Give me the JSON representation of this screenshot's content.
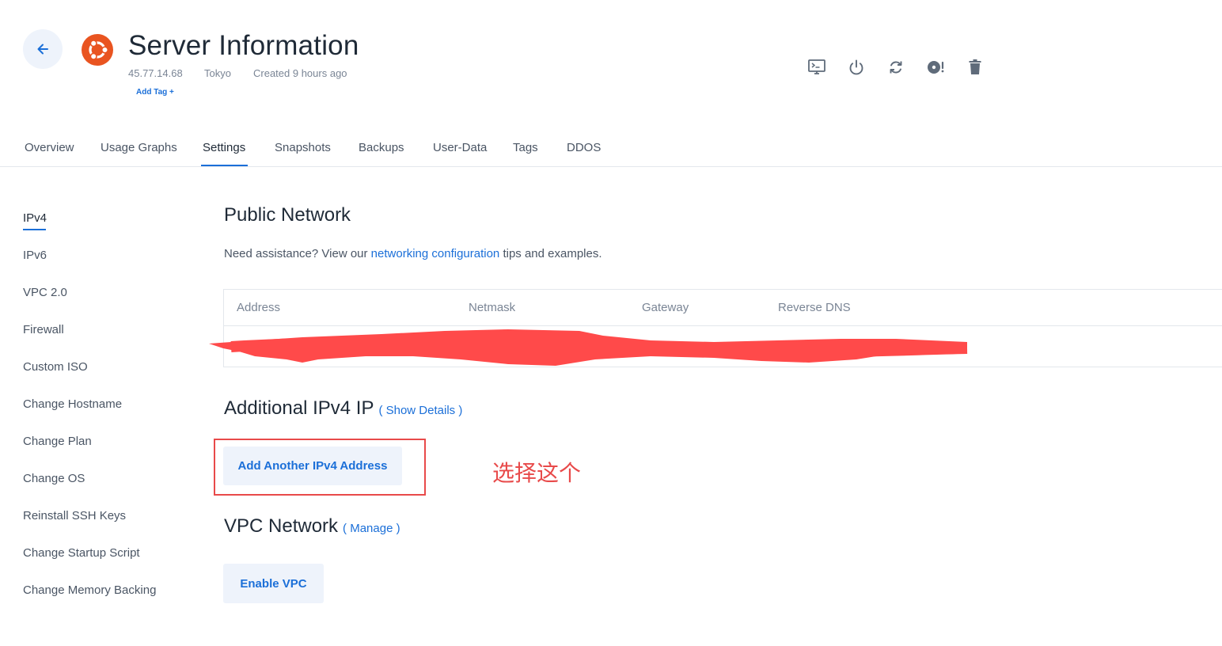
{
  "header": {
    "title": "Server Information",
    "ip": "45.77.14.68",
    "location": "Tokyo",
    "created": "Created 9 hours ago",
    "add_tag": "Add Tag +",
    "os_icon": "ubuntu-icon",
    "actions": [
      "console-icon",
      "power-icon",
      "restart-icon",
      "iso-icon",
      "trash-icon"
    ]
  },
  "tabs": [
    "Overview",
    "Usage Graphs",
    "Settings",
    "Snapshots",
    "Backups",
    "User-Data",
    "Tags",
    "DDOS"
  ],
  "active_tab": "Settings",
  "sidebar": {
    "items": [
      "IPv4",
      "IPv6",
      "VPC 2.0",
      "Firewall",
      "Custom ISO",
      "Change Hostname",
      "Change Plan",
      "Change OS",
      "Reinstall SSH Keys",
      "Change Startup Script",
      "Change Memory Backing"
    ],
    "active": "IPv4"
  },
  "public_network": {
    "title": "Public Network",
    "assist_prefix": "Need assistance? View our ",
    "assist_link": "networking configuration",
    "assist_suffix": " tips and examples.",
    "columns": [
      "Address",
      "Netmask",
      "Gateway",
      "Reverse DNS"
    ]
  },
  "additional_ipv4": {
    "title": "Additional IPv4 IP",
    "details_link": "( Show Details )",
    "button": "Add Another IPv4 Address"
  },
  "vpc_network": {
    "title": "VPC Network",
    "manage_link": "( Manage )",
    "button": "Enable VPC"
  },
  "annotation": "选择这个",
  "colors": {
    "accent": "#1b6fd8",
    "ubuntu": "#e95420",
    "annotation": "#e84a4a",
    "button_bg": "#eef3fb"
  }
}
